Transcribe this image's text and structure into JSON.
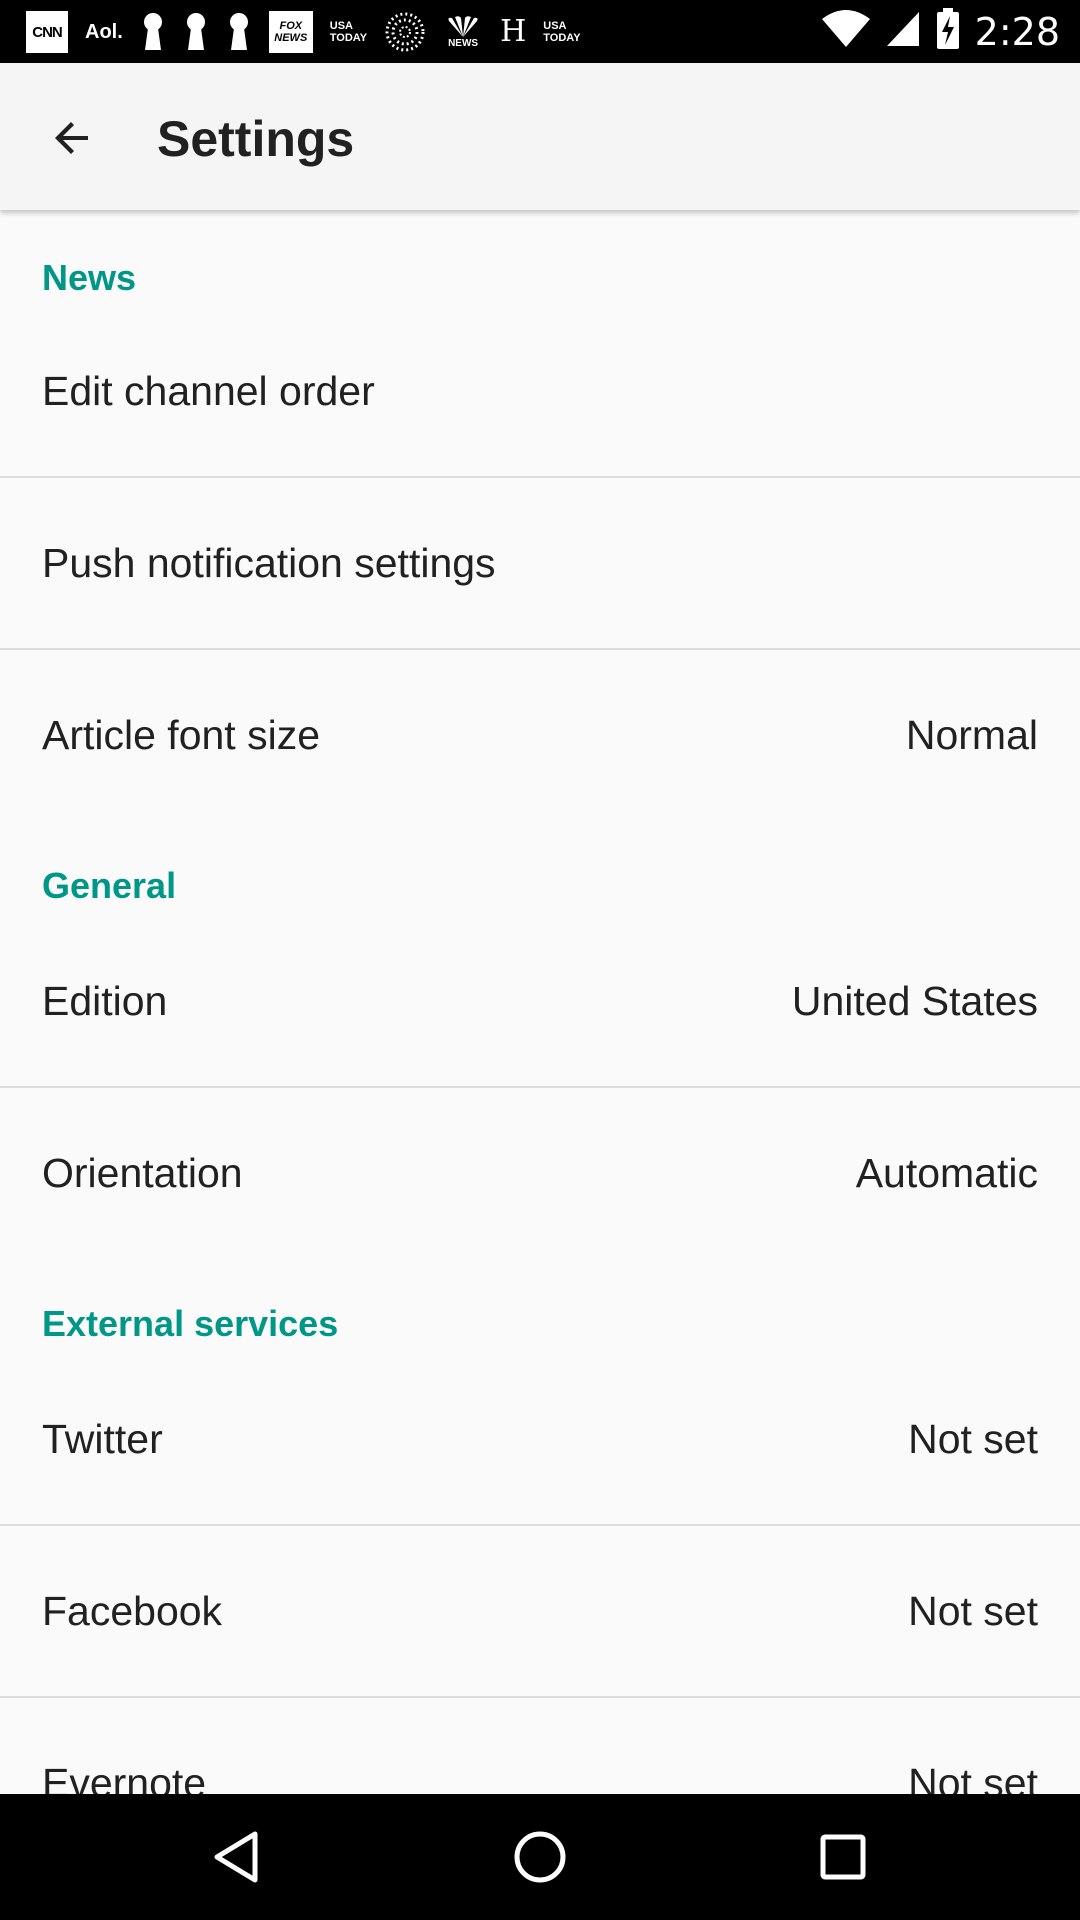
{
  "status_bar": {
    "time": "2:28",
    "notification_icons": [
      "cnn-icon",
      "aol-icon",
      "keyhole-icon",
      "keyhole-icon",
      "keyhole-icon",
      "fox-news-icon",
      "usa-today-icon",
      "globe-dots-icon",
      "nbc-news-icon",
      "h-icon",
      "usa-today-icon"
    ],
    "cnn_text": "CNN",
    "aol_text": "Aol.",
    "fox_line1": "FOX",
    "fox_line2": "NEWS",
    "usa_line1": "USA",
    "usa_line2": "TODAY",
    "nbc_text": "NEWS",
    "h_text": "H"
  },
  "app_bar": {
    "title": "Settings"
  },
  "sections": [
    {
      "header": "News",
      "items": [
        {
          "label": "Edit channel order",
          "value": ""
        },
        {
          "label": "Push notification settings",
          "value": ""
        },
        {
          "label": "Article font size",
          "value": "Normal"
        }
      ]
    },
    {
      "header": "General",
      "items": [
        {
          "label": "Edition",
          "value": "United States"
        },
        {
          "label": "Orientation",
          "value": "Automatic"
        }
      ]
    },
    {
      "header": "External services",
      "items": [
        {
          "label": "Twitter",
          "value": "Not set"
        },
        {
          "label": "Facebook",
          "value": "Not set"
        },
        {
          "label": "Evernote",
          "value": "Not set"
        }
      ]
    }
  ],
  "colors": {
    "accent": "#009688",
    "status_bar": "#000000",
    "app_bar": "#f5f5f5",
    "background": "#fafafa"
  }
}
